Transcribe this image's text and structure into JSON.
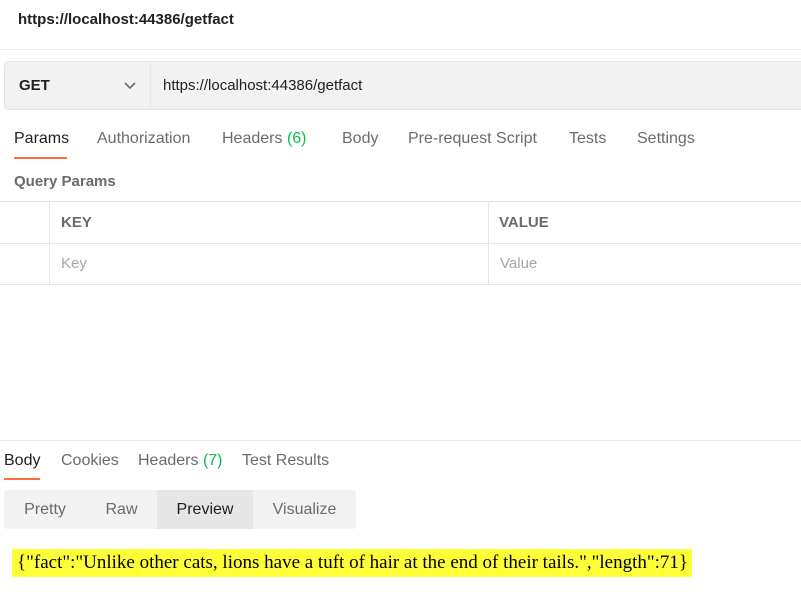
{
  "request": {
    "title": "https://localhost:44386/getfact",
    "method": "GET",
    "url": "https://localhost:44386/getfact"
  },
  "request_tabs": [
    {
      "label": "Params",
      "count": ""
    },
    {
      "label": "Authorization",
      "count": ""
    },
    {
      "label": "Headers",
      "count": "(6)"
    },
    {
      "label": "Body",
      "count": ""
    },
    {
      "label": "Pre-request Script",
      "count": ""
    },
    {
      "label": "Tests",
      "count": ""
    },
    {
      "label": "Settings",
      "count": ""
    }
  ],
  "query_params": {
    "section_label": "Query Params",
    "columns": [
      "KEY",
      "VALUE"
    ],
    "placeholders": {
      "key": "Key",
      "value": "Value"
    }
  },
  "response_tabs": [
    {
      "label": "Body",
      "count": ""
    },
    {
      "label": "Cookies",
      "count": ""
    },
    {
      "label": "Headers",
      "count": "(7)"
    },
    {
      "label": "Test Results",
      "count": ""
    }
  ],
  "view_modes": [
    "Pretty",
    "Raw",
    "Preview",
    "Visualize"
  ],
  "active_view_mode": "Preview",
  "response": {
    "preview_text": "{\"fact\":\"Unlike other cats, lions have a tuft of hair at the end of their tails.\",\"length\":71}"
  },
  "colors": {
    "accent": "#ff6c37",
    "count": "#0cbb52",
    "highlight": "#ffff38"
  },
  "icons": {
    "method_dropdown": "chevron-down-icon"
  }
}
